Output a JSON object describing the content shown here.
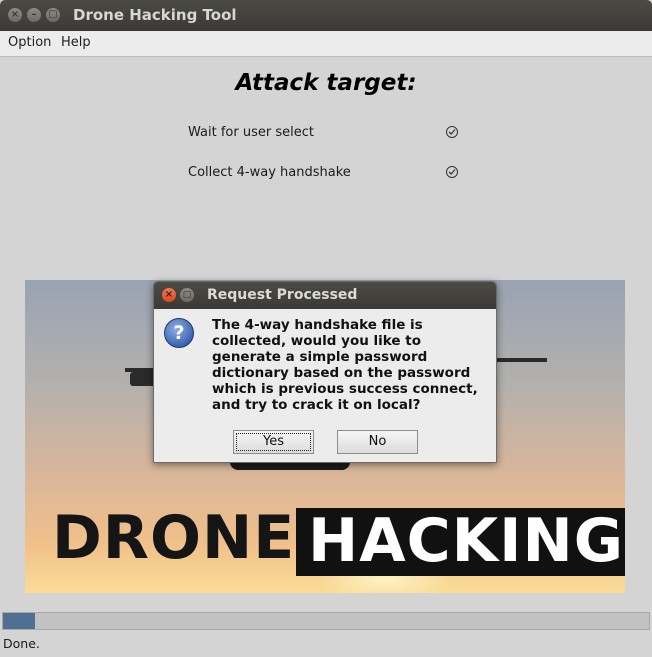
{
  "window": {
    "title": "Drone Hacking Tool",
    "controls": [
      "close-icon",
      "minimize-icon",
      "maximize-icon"
    ]
  },
  "menu": {
    "items": [
      "Option",
      "Help"
    ]
  },
  "main": {
    "heading": "Attack target:",
    "steps": [
      {
        "label": "Wait for user select",
        "status": "check-icon"
      },
      {
        "label": "Collect 4-way handshake",
        "status": "check-icon"
      }
    ]
  },
  "banner": {
    "word1": "DRONE",
    "word2": "HACKING"
  },
  "dialog": {
    "title": "Request Processed",
    "icon": "question-icon",
    "message": "The 4-way handshake file is collected, would you like to generate a simple password dictionary based on the password which is previous success connect, and try to crack it on local?",
    "yes_label": "Yes",
    "no_label": "No"
  },
  "progress": {
    "fraction": 0.05
  },
  "status": {
    "text": "Done."
  },
  "colors": {
    "titlebar": "#3f3e3a",
    "progress_fill": "#4f6f93",
    "dialog_close": "#e05a2a"
  }
}
